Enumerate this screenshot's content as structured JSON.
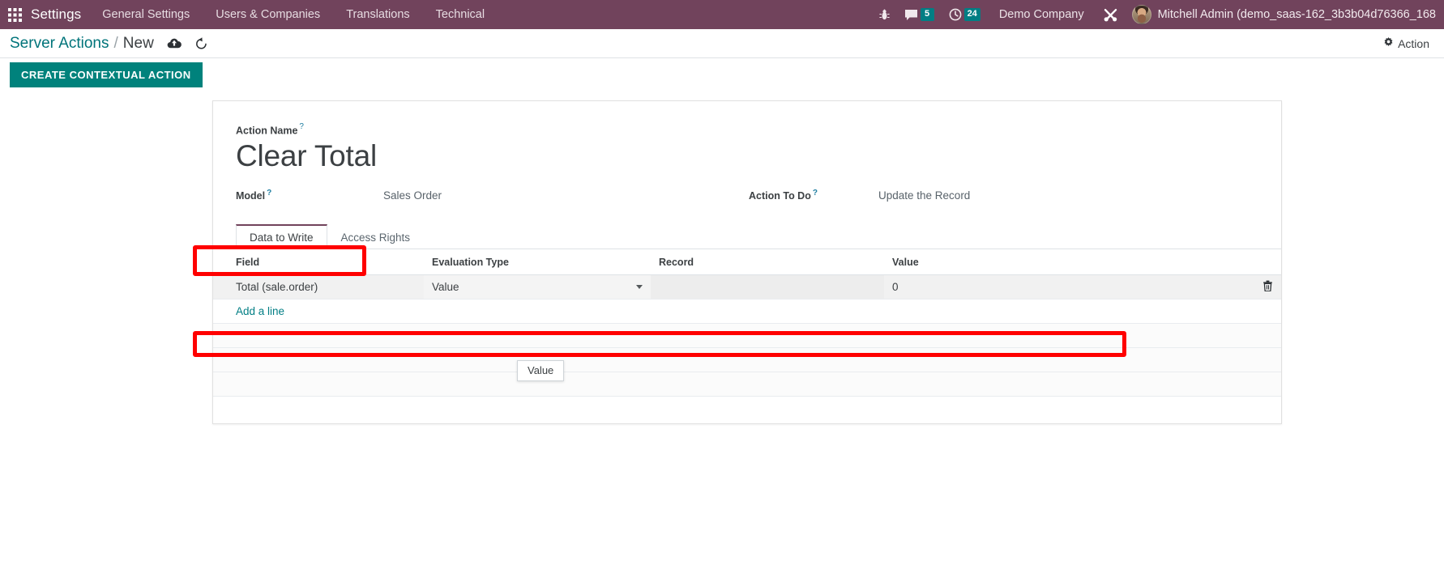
{
  "navbar": {
    "apps_icon": "apps-grid-icon",
    "brand": "Settings",
    "menu_items": [
      {
        "label": "General Settings"
      },
      {
        "label": "Users & Companies"
      },
      {
        "label": "Translations"
      },
      {
        "label": "Technical"
      }
    ],
    "debug_icon": "bug-icon",
    "messages_icon": "chat-bubble-icon",
    "messages_count": "5",
    "activities_icon": "clock-icon",
    "activities_count": "24",
    "company": "Demo Company",
    "tools_icon": "tools-icon",
    "avatar": "user-avatar",
    "user_name": "Mitchell Admin (demo_saas-162_3b3b04d76366_168",
    "bg_color": "#71435c"
  },
  "control_panel": {
    "breadcrumb_parent": "Server Actions",
    "breadcrumb_separator": "/",
    "breadcrumb_current": "New",
    "save_icon": "cloud-upload-icon",
    "discard_icon": "undo-icon",
    "action_icon": "gear-icon",
    "action_label": "Action"
  },
  "button_box": {
    "create_contextual_action": "CREATE CONTEXTUAL ACTION",
    "accent_color": "#00827c"
  },
  "form": {
    "action_name_label": "Action Name",
    "help_marker": "?",
    "action_name_value": "Clear Total",
    "model_label": "Model",
    "model_value": "Sales Order",
    "action_to_do_label": "Action To Do",
    "action_to_do_value": "Update the Record"
  },
  "notebook": {
    "tabs": [
      {
        "label": "Data to Write",
        "active": true
      },
      {
        "label": "Access Rights",
        "active": false
      }
    ]
  },
  "list": {
    "columns": [
      "Field",
      "Evaluation Type",
      "Record",
      "Value"
    ],
    "rows": [
      {
        "field": "Total (sale.order)",
        "evaluation_type": "Value",
        "record": "",
        "value": "0",
        "delete_icon": "trash-icon"
      }
    ],
    "add_line_label": "Add a line"
  },
  "floating_dropdown": {
    "label": "Value"
  },
  "annotations": {
    "highlight_color": "#ff0000",
    "boxes": [
      "model-field",
      "data-to-write-row"
    ]
  }
}
